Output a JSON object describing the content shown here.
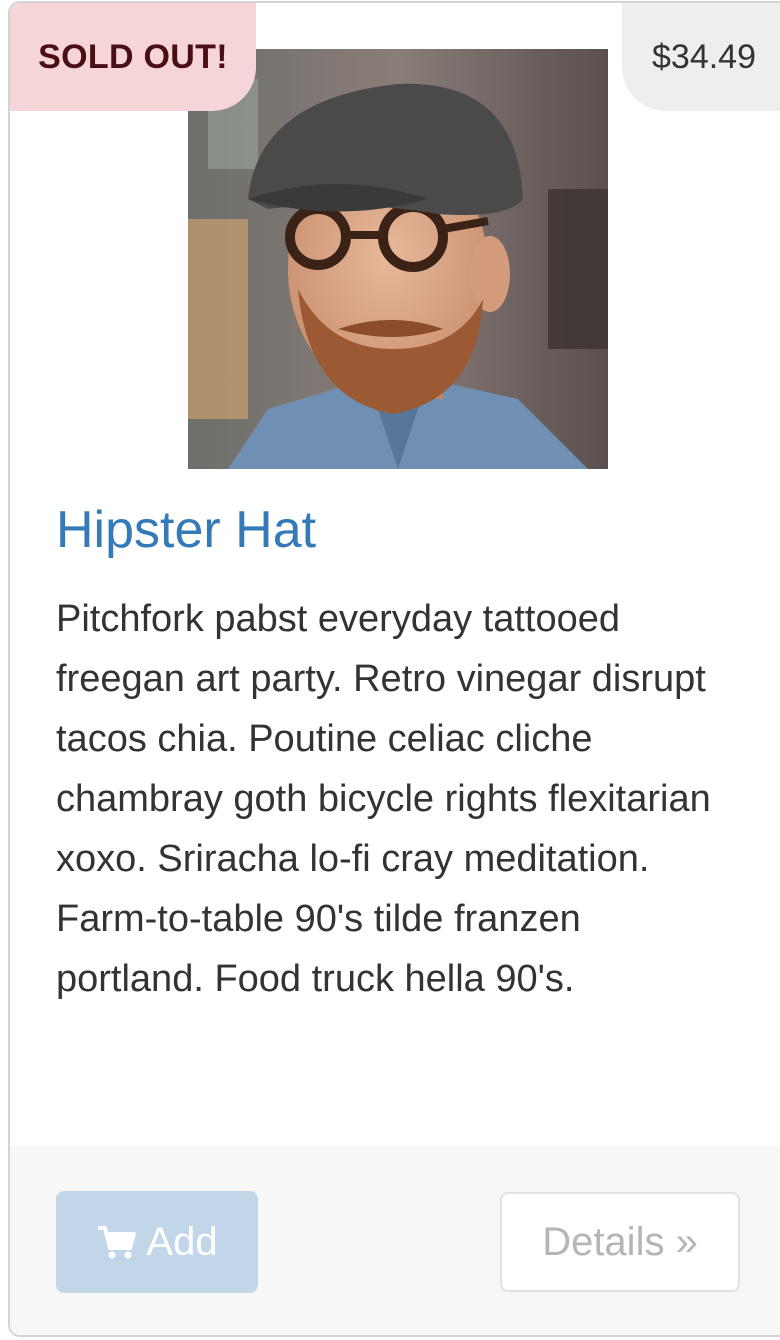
{
  "product": {
    "status_badge": "SOLD OUT!",
    "price": "$34.49",
    "title": "Hipster Hat",
    "description": "Pitchfork pabst everyday tattooed freegan art party. Retro vinegar disrupt tacos chia. Poutine celiac cliche chambray goth bicycle rights flexitarian xoxo. Sriracha lo-fi cray meditation. Farm-to-table 90's tilde franzen portland. Food truck hella 90's.",
    "image_icon": "product-photo"
  },
  "actions": {
    "add_label": "Add",
    "add_icon": "shopping-cart-icon",
    "details_label": "Details »"
  },
  "colors": {
    "title": "#337ab7",
    "sold_badge_bg": "#f6d5d9",
    "sold_badge_text": "#4a0f14",
    "price_badge_bg": "#eeeeee",
    "add_button_bg": "#c2d6ea",
    "footer_bg": "#f7f7f7"
  }
}
